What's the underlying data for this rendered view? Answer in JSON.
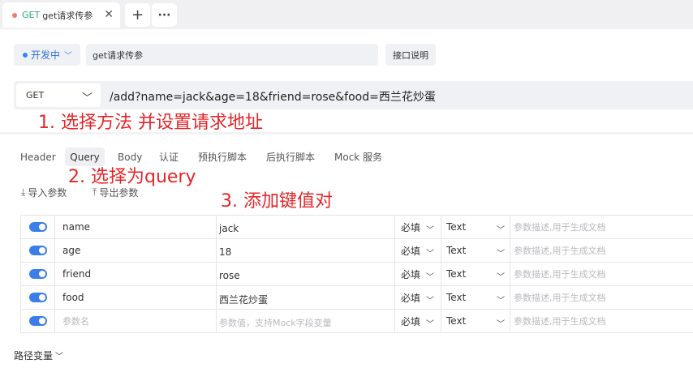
{
  "tabbar": {
    "tab_method": "GET",
    "tab_title": "get请求传参",
    "close_glyph": "✕",
    "add_glyph": "+",
    "more_glyph": "···"
  },
  "request": {
    "env_label": "开发中",
    "name_value": "get请求传参",
    "doc_button": "接口说明",
    "method": "GET",
    "url": "/add?name=jack&age=18&friend=rose&food=西兰花炒蛋"
  },
  "annotations": {
    "step1": "1. 选择方法 并设置请求地址",
    "step2": "2. 选择为query",
    "step3": "3. 添加键值对"
  },
  "subtabs": [
    "Header",
    "Query",
    "Body",
    "认证",
    "预执行脚本",
    "后执行脚本",
    "Mock 服务"
  ],
  "active_subtab": "Query",
  "actions": {
    "import": "导入参数",
    "export": "导出参数"
  },
  "params": [
    {
      "enabled": true,
      "name": "name",
      "value": "jack",
      "required": "必填",
      "type": "Text",
      "desc_placeholder": "参数描述,用于生成文档"
    },
    {
      "enabled": true,
      "name": "age",
      "value": "18",
      "required": "必填",
      "type": "Text",
      "desc_placeholder": "参数描述,用于生成文档"
    },
    {
      "enabled": true,
      "name": "friend",
      "value": "rose",
      "required": "必填",
      "type": "Text",
      "desc_placeholder": "参数描述,用于生成文档"
    },
    {
      "enabled": true,
      "name": "food",
      "value": "西兰花炒蛋",
      "required": "必填",
      "type": "Text",
      "desc_placeholder": "参数描述,用于生成文档"
    }
  ],
  "new_row": {
    "name_placeholder": "参数名",
    "value_placeholder": "参数值，支持Mock字段变量",
    "required": "必填",
    "type": "Text",
    "desc_placeholder": "参数描述,用于生成文档"
  },
  "path_vars_label": "路径变量",
  "colors": {
    "accent": "#3b7ee8",
    "annotation": "#e5262a",
    "method_green": "#2fa779"
  }
}
